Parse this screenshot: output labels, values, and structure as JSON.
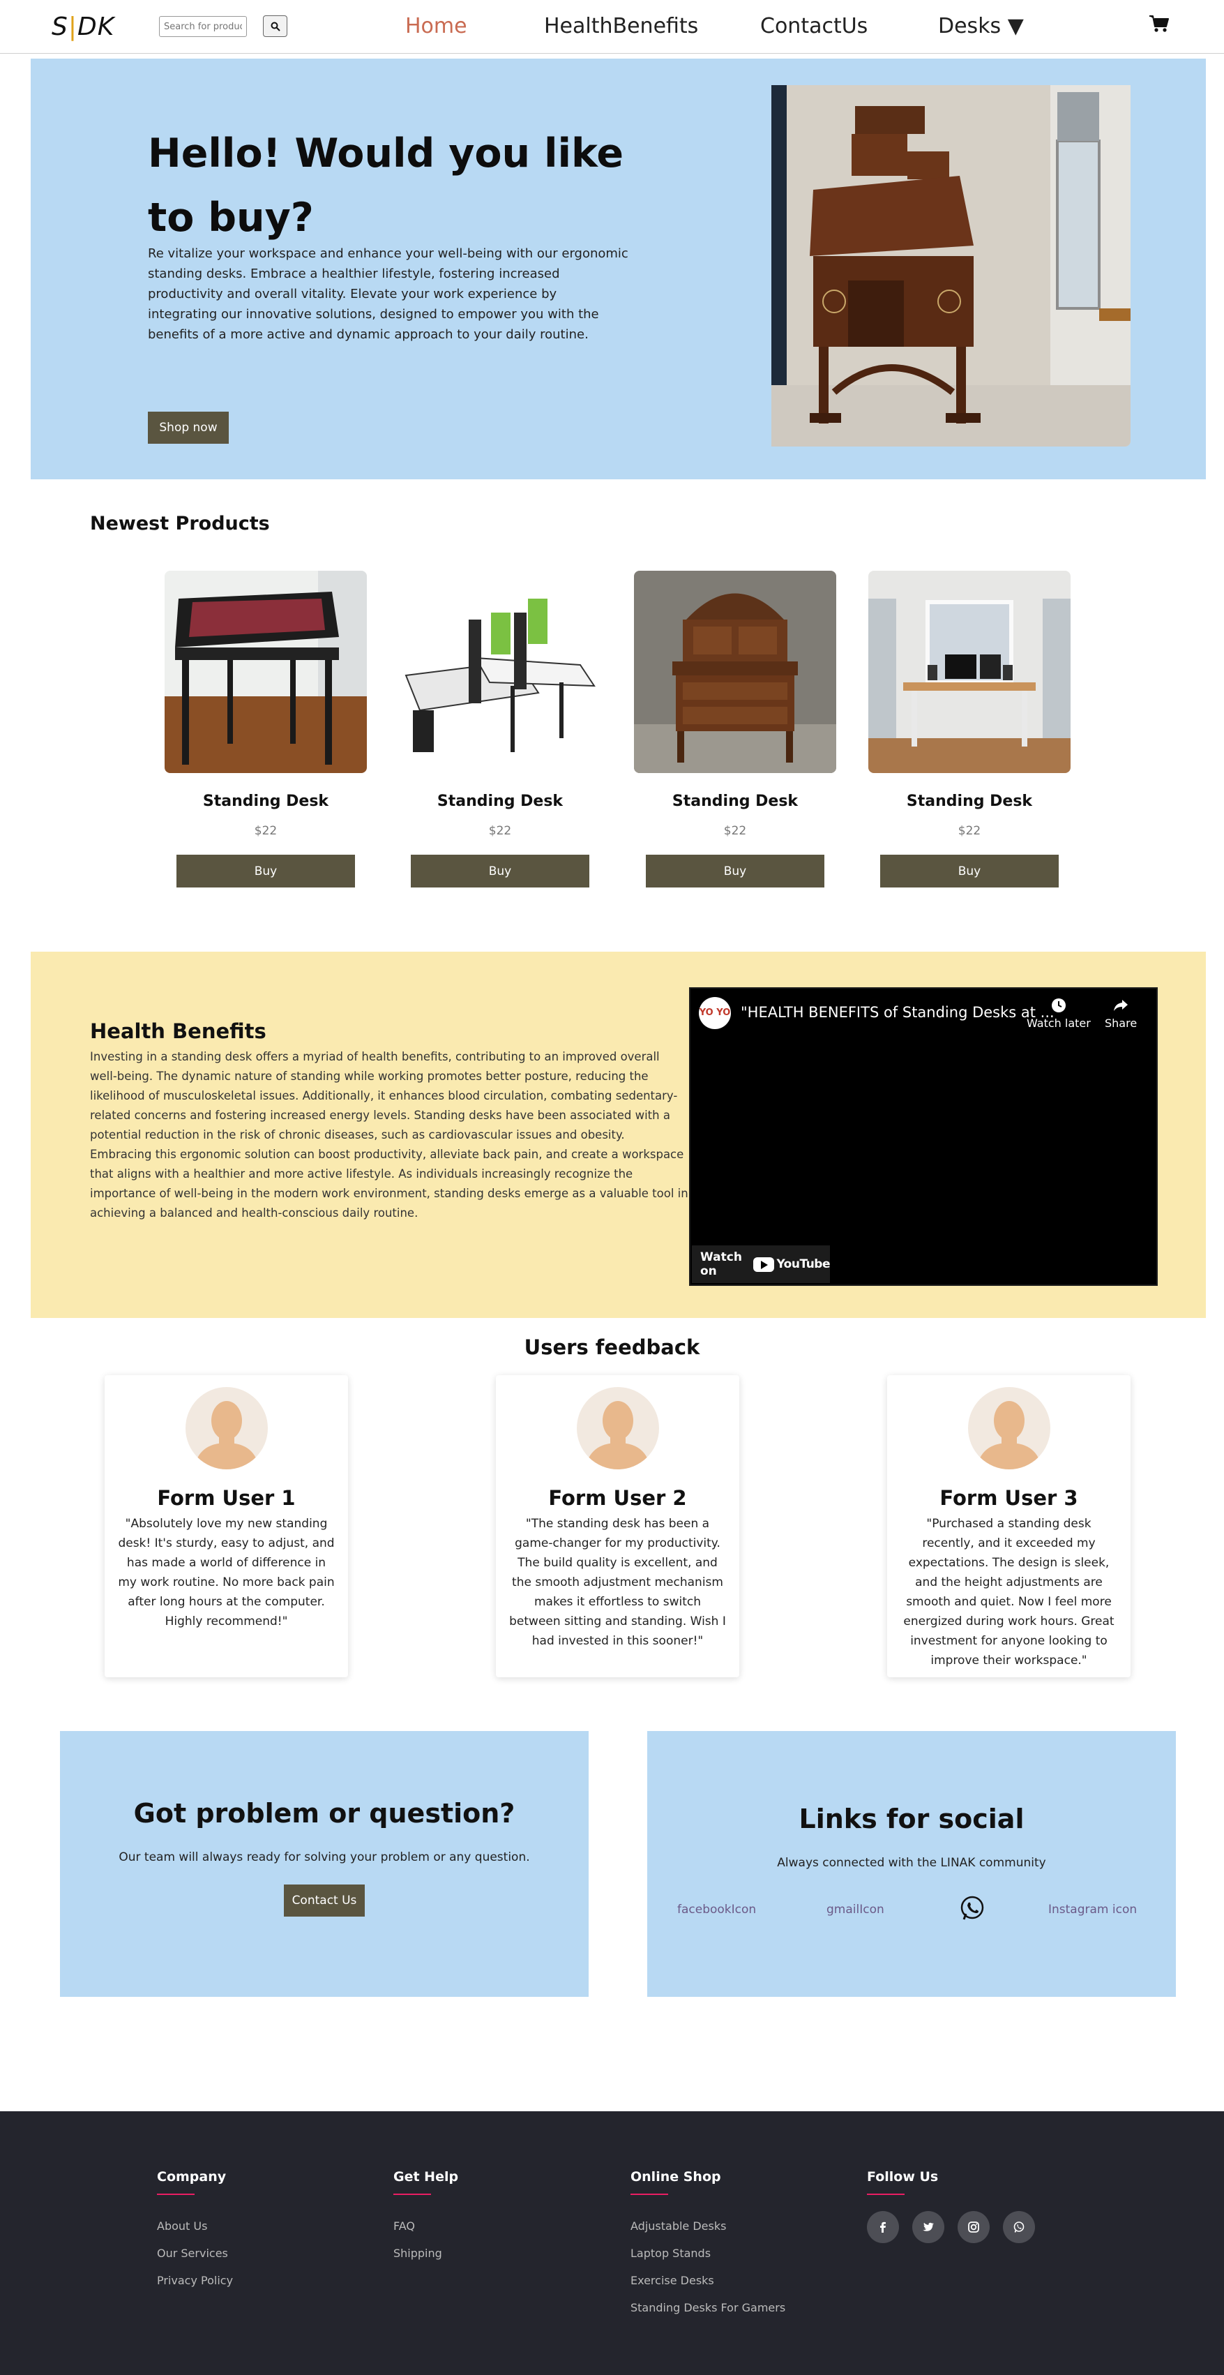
{
  "nav": {
    "logo_left": "S",
    "logo_bar": "|",
    "logo_right": "DK",
    "search_placeholder": "Search for products",
    "links": [
      "Home",
      "HealthBenefits",
      "ContactUs",
      "Desks ▼"
    ],
    "active_link": "Home",
    "cart_icon": "cart-icon"
  },
  "hero": {
    "title": "Hello! Would you like to buy?",
    "text": "Re vitalize your workspace and enhance your well-being with our ergonomic standing desks. Embrace a healthier lifestyle, fostering increased productivity and overall vitality. Elevate your work experience by integrating our innovative solutions, designed to empower you with the benefits of a more active and dynamic approach to your daily routine.",
    "button": "Shop now"
  },
  "newest": {
    "title": "Newest Products",
    "products": [
      {
        "name": "Standing Desk",
        "price": "$22",
        "button": "Buy"
      },
      {
        "name": "Standing Desk",
        "price": "$22",
        "button": "Buy"
      },
      {
        "name": "Standing Desk",
        "price": "$22",
        "button": "Buy"
      },
      {
        "name": "Standing Desk",
        "price": "$22",
        "button": "Buy"
      }
    ]
  },
  "health": {
    "title": "Health Benefits",
    "text": "Investing in a standing desk offers a myriad of health benefits, contributing to an improved overall well-being. The dynamic nature of standing while working promotes better posture, reducing the likelihood of musculoskeletal issues. Additionally, it enhances blood circulation, combating sedentary-related concerns and fostering increased energy levels. Standing desks have been associated with a potential reduction in the risk of chronic diseases, such as cardiovascular issues and obesity. Embracing this ergonomic solution can boost productivity, alleviate back pain, and create a workspace that aligns with a healthier and more active lifestyle. As individuals increasingly recognize the importance of well-being in the modern work environment, standing desks emerge as a valuable tool in achieving a balanced and health-conscious daily routine.",
    "video": {
      "channel_badge": "YO YO",
      "title": "\"HEALTH BENEFITS of Standing Desks at ...",
      "watch_later": "Watch later",
      "share": "Share",
      "watch_on": "Watch on",
      "youtube": "YouTube"
    }
  },
  "feedback": {
    "title": "Users feedback",
    "users": [
      {
        "name": "Form User 1",
        "quote": "\"Absolutely love my new standing desk! It's sturdy, easy to adjust, and has made a world of difference in my work routine. No more back pain after long hours at the computer. Highly recommend!\""
      },
      {
        "name": "Form User 2",
        "quote": "\"The standing desk has been a game-changer for my productivity. The build quality is excellent, and the smooth adjustment mechanism makes it effortless to switch between sitting and standing. Wish I had invested in this sooner!\""
      },
      {
        "name": "Form User 3",
        "quote": "\"Purchased a standing desk recently, and it exceeded my expectations. The design is sleek, and the height adjustments are smooth and quiet. Now I feel more energized during work hours. Great investment for anyone looking to improve their workspace.\""
      }
    ]
  },
  "contact": {
    "title": "Got problem or question?",
    "sub": "Our team will always ready for solving your problem or any question.",
    "button": "Contact Us"
  },
  "social": {
    "title": "Links for social",
    "sub": "Always connected with the LINAK community",
    "facebook_alt": "facebookIcon",
    "gmail_alt": "gmailIcon",
    "instagram_alt": "Instagram icon"
  },
  "footer": {
    "company": {
      "title": "Company",
      "links": [
        "About Us",
        "Our Services",
        "Privacy Policy"
      ]
    },
    "help": {
      "title": "Get Help",
      "links": [
        "FAQ",
        "Shipping"
      ]
    },
    "shop": {
      "title": "Online Shop",
      "links": [
        "Adjustable Desks",
        "Laptop Stands",
        "Exercise Desks",
        "Standing Desks For Gamers"
      ]
    },
    "follow": {
      "title": "Follow Us"
    }
  },
  "colors": {
    "accent_button": "#5a5540",
    "active_nav": "#c96b52",
    "hero_bg": "#b8d9f3",
    "health_bg": "#faeab0",
    "footer_bg": "#24252d",
    "footer_underline": "#e91e63"
  }
}
